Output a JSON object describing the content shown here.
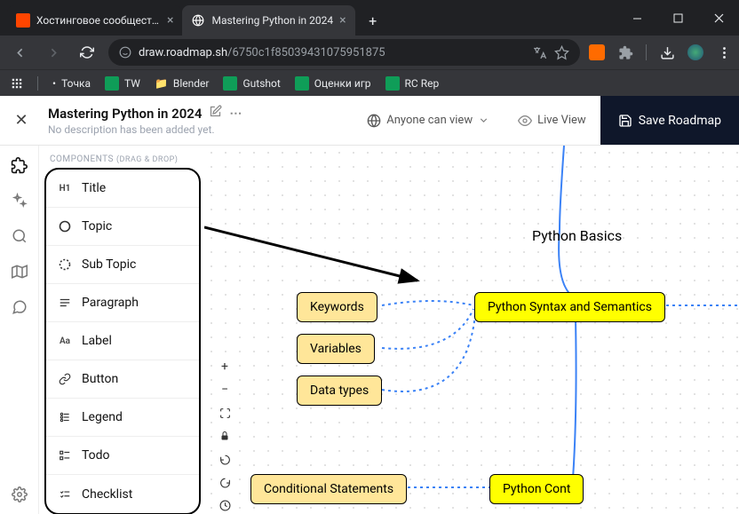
{
  "browser": {
    "tabs": [
      {
        "title": "Хостинговое сообщество «Tin",
        "active": false
      },
      {
        "title": "Mastering Python in 2024",
        "active": true
      }
    ],
    "url_host": "draw.roadmap.sh",
    "url_path": "/6750c1f85039431075951875",
    "bookmarks": [
      {
        "label": "Точка",
        "type": "bullet"
      },
      {
        "label": "TW",
        "type": "sheet"
      },
      {
        "label": "Blender",
        "type": "folder"
      },
      {
        "label": "Gutshot",
        "type": "sheet"
      },
      {
        "label": "Оценки игр",
        "type": "sheet"
      },
      {
        "label": "RC Rep",
        "type": "sheet"
      }
    ]
  },
  "header": {
    "title": "Mastering Python in 2024",
    "description": "No description has been added yet.",
    "anyone": "Anyone can view",
    "live": "Live View",
    "save": "Save Roadmap"
  },
  "sidebar": {
    "section": "COMPONENTS",
    "hint": "(DRAG & DROP)",
    "items": [
      {
        "icon": "H1",
        "label": "Title"
      },
      {
        "icon": "circle",
        "label": "Topic"
      },
      {
        "icon": "dashed-circle",
        "label": "Sub Topic"
      },
      {
        "icon": "paragraph",
        "label": "Paragraph"
      },
      {
        "icon": "Aa",
        "label": "Label"
      },
      {
        "icon": "link",
        "label": "Button"
      },
      {
        "icon": "legend",
        "label": "Legend"
      },
      {
        "icon": "todo",
        "label": "Todo"
      },
      {
        "icon": "checklist",
        "label": "Checklist"
      }
    ]
  },
  "canvas": {
    "nodes": {
      "basics": "Python Basics",
      "keywords": "Keywords",
      "variables": "Variables",
      "datatypes": "Data types",
      "syntax": "Python Syntax and Semantics",
      "conditional": "Conditional Statements",
      "control": "Python Cont"
    }
  }
}
